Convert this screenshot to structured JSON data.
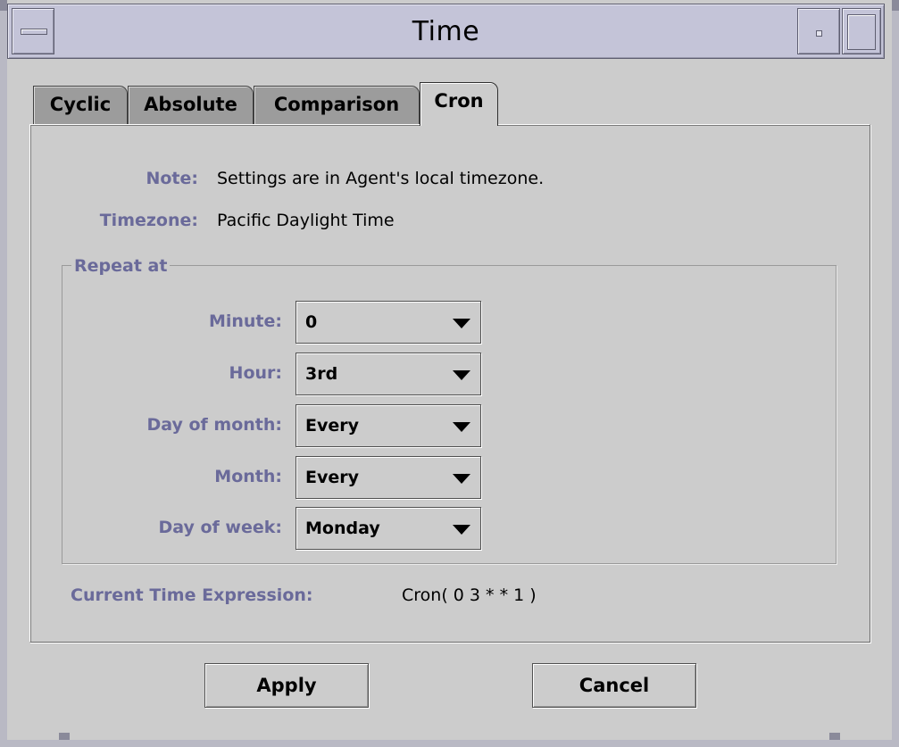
{
  "window": {
    "title": "Time"
  },
  "tabs": [
    {
      "label": "Cyclic",
      "active": false
    },
    {
      "label": "Absolute",
      "active": false
    },
    {
      "label": "Comparison",
      "active": false
    },
    {
      "label": "Cron",
      "active": true
    }
  ],
  "note": {
    "label": "Note:",
    "value": "Settings are in Agent's local timezone."
  },
  "timezone": {
    "label": "Timezone:",
    "value": "Pacific Daylight Time"
  },
  "repeat_group": {
    "title": "Repeat at",
    "fields": [
      {
        "label": "Minute:",
        "value": "0"
      },
      {
        "label": "Hour:",
        "value": "3rd"
      },
      {
        "label": "Day of month:",
        "value": "Every"
      },
      {
        "label": "Month:",
        "value": "Every"
      },
      {
        "label": "Day of week:",
        "value": "Monday"
      }
    ]
  },
  "expression": {
    "label": "Current Time Expression:",
    "value": "Cron( 0 3 * * 1 )"
  },
  "buttons": {
    "apply": "Apply",
    "cancel": "Cancel"
  },
  "colors": {
    "label": "#6a6a9a",
    "background": "#cccccc",
    "titlebar": "#c4c4d8",
    "inactive_tab": "#9c9c9c"
  },
  "icons": {
    "window_menu": "window-menu-icon",
    "minimize": "minimize-icon",
    "maximize": "maximize-icon",
    "dropdown": "triangle-down-icon"
  }
}
